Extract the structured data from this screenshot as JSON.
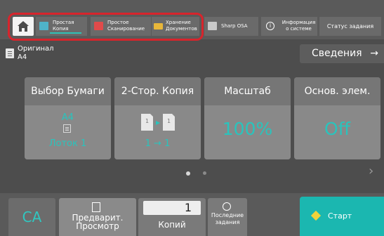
{
  "header": {
    "tabs": [
      {
        "label": "Простая\nКопия",
        "icon": "copy-icon",
        "active": true
      },
      {
        "label": "Простое\nСканирование",
        "icon": "scan-icon"
      },
      {
        "label": "Хранение\nДокументов",
        "icon": "folder-icon"
      },
      {
        "label": "Sharp OSA",
        "icon": "app-icon"
      },
      {
        "label": "Информация\nо системе",
        "icon": "info-icon"
      },
      {
        "label": "Статус задания"
      }
    ]
  },
  "original": {
    "label": "Оригинал",
    "value": "A4"
  },
  "details": {
    "label": "Сведения",
    "arrow": "→"
  },
  "tiles": {
    "paper": {
      "title": "Выбор Бумаги",
      "size": "A4",
      "tray": "Лоток 1"
    },
    "duplex": {
      "title": "2-Стор. Копия",
      "value": "1 → 1"
    },
    "zoom": {
      "title": "Масштаб",
      "value": "100%"
    },
    "basic": {
      "title": "Основ. элем.",
      "value": "Off"
    }
  },
  "pagination": {
    "total": 2,
    "current": 1,
    "next": "›"
  },
  "bottom": {
    "ca": "CA",
    "preview": "Предварит.\nПросмотр",
    "copies": {
      "value": "1",
      "label": "Копий"
    },
    "recent": "Последние\nзадания",
    "start": "Старт"
  },
  "colors": {
    "accent": "#2ec1b6",
    "start": "#1bb7b0",
    "highlight": "#d8242c"
  }
}
